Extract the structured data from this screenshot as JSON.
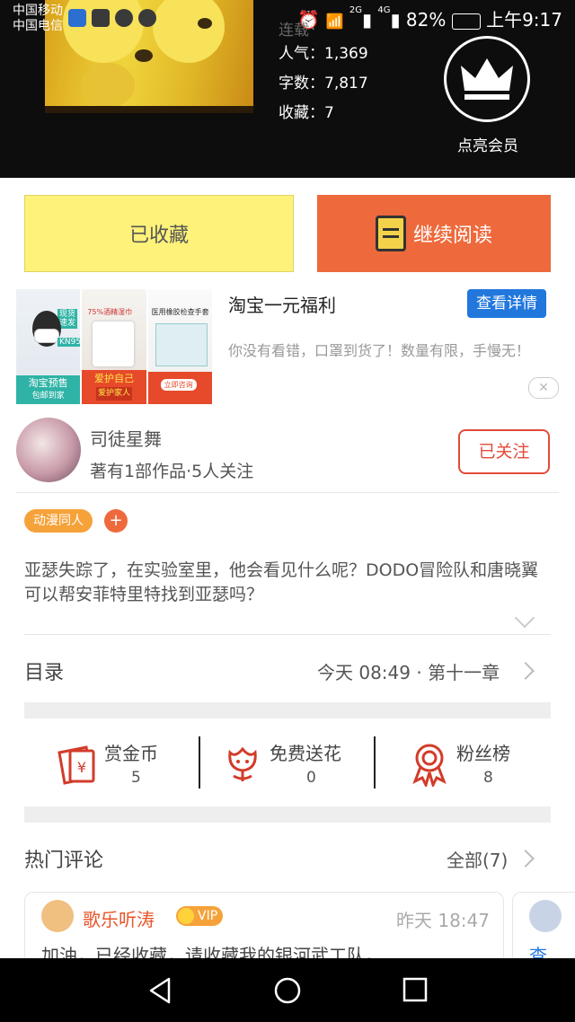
{
  "status_bar": {
    "carrier1": "中国移动",
    "carrier2": "中国电信",
    "signal_2g": "2G",
    "signal_4g": "4G",
    "battery": "82%",
    "time": "上午9:17"
  },
  "book": {
    "status_partial": "连载",
    "popularity": "人气：1,369",
    "word_count": "字数：7,817",
    "favorites": "收藏：7"
  },
  "vip": {
    "label": "点亮会员",
    "icon": "crown-icon"
  },
  "actions": {
    "favorited_label": "已收藏",
    "continue_label": "继续阅读"
  },
  "ad": {
    "title": "淘宝一元福利",
    "button": "查看详情",
    "description": "你没有看错，口罩到货了！数量有限，手慢无！",
    "close": "✕",
    "panel1_tag": "现货速发",
    "panel1_kn": "KN95",
    "panel1_bottom": "淘宝预售",
    "panel1_bottom2": "包邮到家",
    "panel2_top": "75%酒精湿巾",
    "panel2_bottom": "爱护自己",
    "panel2_bottom2": "爱护家人",
    "panel3_top": "医用橡胶检查手套",
    "panel3_bottom": "立即咨询"
  },
  "author": {
    "name": "司徒星舞",
    "subtitle": "著有1部作品·5人关注",
    "follow": "已关注"
  },
  "tags": [
    "动漫同人"
  ],
  "tag_add": "+",
  "description": "亚瑟失踪了，在实验室里，他会看见什么呢？DODO冒险队和唐晓翼可以帮安菲特里特找到亚瑟吗？",
  "catalog": {
    "title": "目录",
    "latest": "今天 08:49 · 第十一章"
  },
  "rewards": [
    {
      "label": "赏金币",
      "value": "5",
      "icon": "coin-envelope-icon"
    },
    {
      "label": "免费送花",
      "value": "0",
      "icon": "flower-icon"
    },
    {
      "label": "粉丝榜",
      "value": "8",
      "icon": "medal-icon"
    }
  ],
  "comments": {
    "title": "热门评论",
    "all": "全部(7)",
    "items": [
      {
        "user": "歌乐听涛",
        "badge": "VIP",
        "time": "昨天 18:47",
        "text": "加油，已经收藏，请收藏我的银河武工队，"
      }
    ],
    "peek_text": "查"
  },
  "colors": {
    "accent": "#ee6a3c",
    "favorite_bg": "#fff27a",
    "link_blue": "#2277dd",
    "follow_red": "#e24a3a",
    "tag_orange": "#f6a23a"
  }
}
